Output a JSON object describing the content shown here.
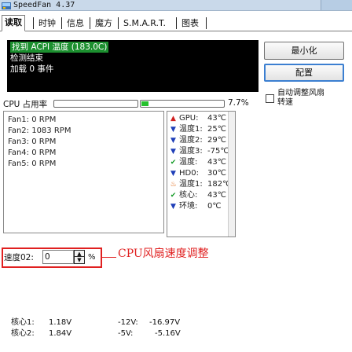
{
  "window": {
    "title": "SpeedFan 4.37"
  },
  "tabs": [
    {
      "label": "读取",
      "active": true
    },
    {
      "label": "时钟",
      "active": false
    },
    {
      "label": "信息",
      "active": false
    },
    {
      "label": "魔方",
      "active": false
    },
    {
      "label": "S.M.A.R.T.",
      "active": false
    },
    {
      "label": "图表",
      "active": false
    }
  ],
  "log": [
    {
      "text": "找到 ACPI 温度 (183.0C)",
      "highlight": true
    },
    {
      "text": "检测结束",
      "highlight": false
    },
    {
      "text": "加载 0 事件",
      "highlight": false
    }
  ],
  "buttons": {
    "minimize": "最小化",
    "configure": "配置"
  },
  "auto_fan": {
    "label_line1": "自动调整风扇",
    "label_line2": "转速",
    "checked": false
  },
  "cpu_usage": {
    "label": "CPU 占用率",
    "percent": "7.7%",
    "bars": [
      0.0,
      0.09
    ]
  },
  "fans": [
    "Fan1: 0 RPM",
    "Fan2: 1083 RPM",
    "Fan3: 0 RPM",
    "Fan4: 0 RPM",
    "Fan5: 0 RPM"
  ],
  "temps": [
    {
      "name": "GPU:",
      "value": "43℃",
      "icon": "arrow-up-icon"
    },
    {
      "name": "温度1:",
      "value": "25℃",
      "icon": "arrow-down-icon"
    },
    {
      "name": "温度2:",
      "value": "29℃",
      "icon": "arrow-down-icon"
    },
    {
      "name": "温度3:",
      "value": "-75℃",
      "icon": "arrow-down-icon"
    },
    {
      "name": "温度:",
      "value": "43℃",
      "icon": "check-icon"
    },
    {
      "name": "HD0:",
      "value": "30℃",
      "icon": "arrow-down-icon"
    },
    {
      "name": "温度1:",
      "value": "182℃",
      "icon": "fire-icon"
    },
    {
      "name": "核心:",
      "value": "43℃",
      "icon": "check-icon"
    },
    {
      "name": "环境:",
      "value": "0℃",
      "icon": "arrow-down-icon"
    }
  ],
  "speed_control": {
    "label": "速度02:",
    "value": "0",
    "unit": "%"
  },
  "annotation": "CPU风扇速度调整",
  "voltages_left": [
    {
      "label": "核心1:",
      "value": "1.18V"
    },
    {
      "label": "核心2:",
      "value": "1.84V"
    }
  ],
  "voltages_right": [
    {
      "label": "-12V:",
      "value": "-16.97V"
    },
    {
      "label": "-5V:",
      "value": "-5.16V"
    }
  ]
}
